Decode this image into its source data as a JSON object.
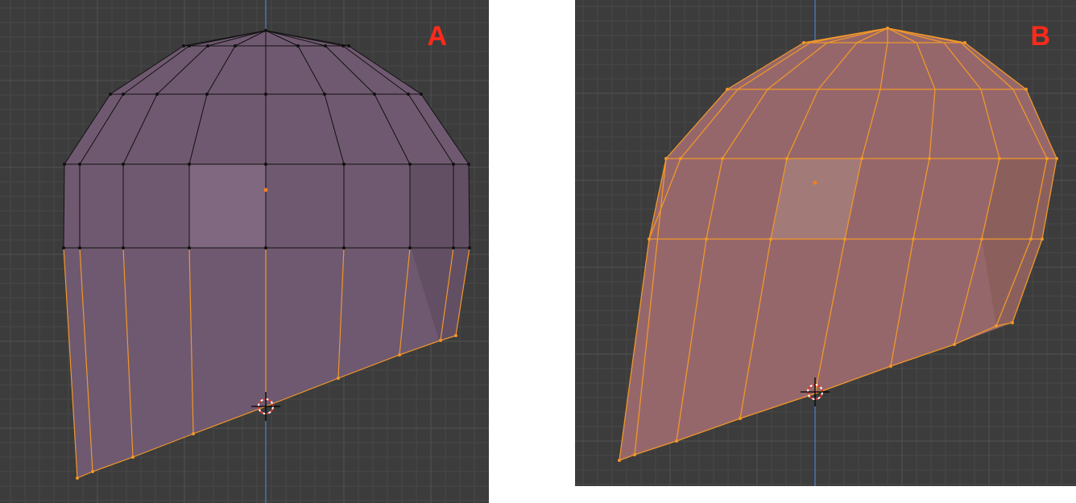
{
  "panels": [
    {
      "label": "A"
    },
    {
      "label": "B"
    }
  ],
  "colors": {
    "viewport_bg": "#3c3c3c",
    "grid_minor": "#444444",
    "grid_major": "#4d4d4d",
    "axis_line": "#4f7fcc",
    "mesh_fill_a": "#6f5970",
    "mesh_fill_b": "#96676a",
    "edge_unselected": "#111111",
    "edge_selected": "#f0972a",
    "label": "#ff2a1a",
    "cursor_ring_red": "#e03030",
    "origin_dot": "#f08020"
  },
  "icons": [
    "3d-cursor-icon",
    "object-origin-icon"
  ]
}
